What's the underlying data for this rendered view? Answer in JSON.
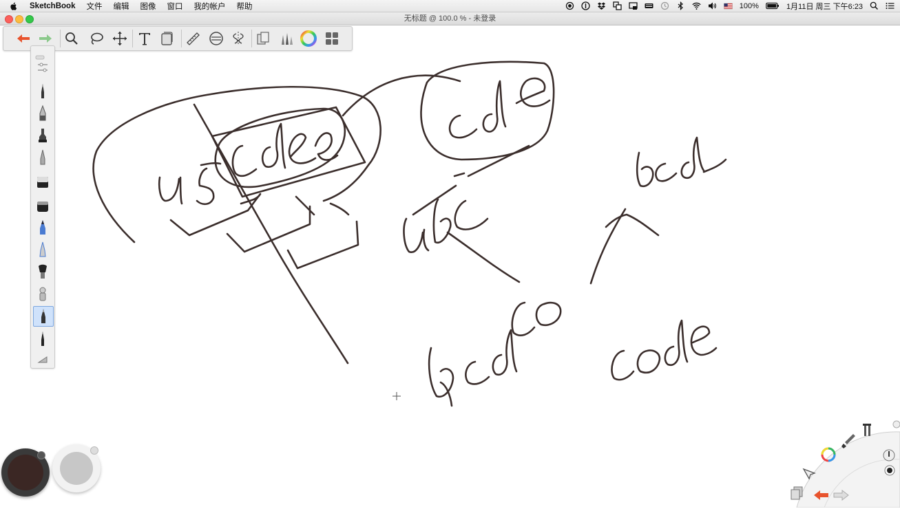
{
  "menubar": {
    "app_name": "SketchBook",
    "items": [
      "文件",
      "编辑",
      "图像",
      "窗口",
      "我的帐户",
      "帮助"
    ],
    "battery": "100%",
    "datetime": "1月11日 周三 下午6:23"
  },
  "window": {
    "title": "无标题 @ 100.0 % - 未登录"
  },
  "toolbar": {
    "tools": [
      "undo-icon",
      "redo-icon",
      "zoom-icon",
      "lasso-icon",
      "move-icon",
      "text-icon",
      "layer-icon",
      "ruler-icon",
      "ellipse-icon",
      "symmetry-icon",
      "copy-icon",
      "brushes-icon",
      "color-wheel-icon",
      "layout-icon"
    ]
  },
  "palette": {
    "tools": [
      "settings-icon",
      "pencil-icon",
      "ink-pen-icon",
      "marker-icon",
      "fine-pen-icon",
      "eraser-icon",
      "hard-eraser-icon",
      "airbrush-icon",
      "felt-pen-icon",
      "paint-brush-icon",
      "smudge-icon",
      "ballpoint-icon",
      "technical-pen-icon",
      "ruler-guide-icon"
    ],
    "active_index": 11
  },
  "colors": {
    "primary": "#3b2724",
    "secondary": "#c7c7c7",
    "ink": "#3b2e2c",
    "undo": "#e8532d",
    "redo": "#8bc98b"
  },
  "canvas": {
    "strokes_description": "handwritten"
  }
}
